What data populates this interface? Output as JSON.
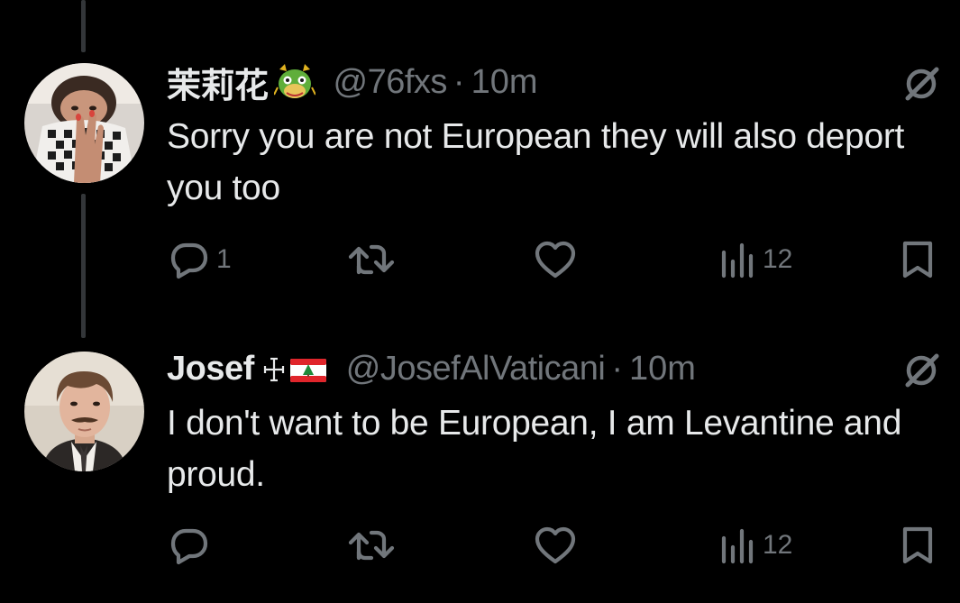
{
  "tweets": [
    {
      "display_name": "茉莉花",
      "badge_emoji": "🐲",
      "handle": "@76fxs",
      "separator": "·",
      "time": "10m",
      "text": "Sorry you are not European they will also deport you too",
      "reply_count": "1",
      "retweet_count": "",
      "like_count": "",
      "views_count": "12"
    },
    {
      "display_name": "Josef",
      "badge_emoji": "☩🇱🇧",
      "handle": "@JosefAlVaticani",
      "separator": "·",
      "time": "10m",
      "text": "I don't want to be European, I am Levantine and proud.",
      "reply_count": "",
      "retweet_count": "",
      "like_count": "",
      "views_count": "12"
    }
  ],
  "icons": {
    "reply": "reply-icon",
    "retweet": "retweet-icon",
    "like": "heart-icon",
    "views": "views-icon",
    "bookmark": "bookmark-icon",
    "grok": "grok-icon"
  },
  "colors": {
    "background": "#000000",
    "primary_text": "#e7e9ea",
    "secondary_text": "#71767b",
    "thread_line": "#333639"
  }
}
